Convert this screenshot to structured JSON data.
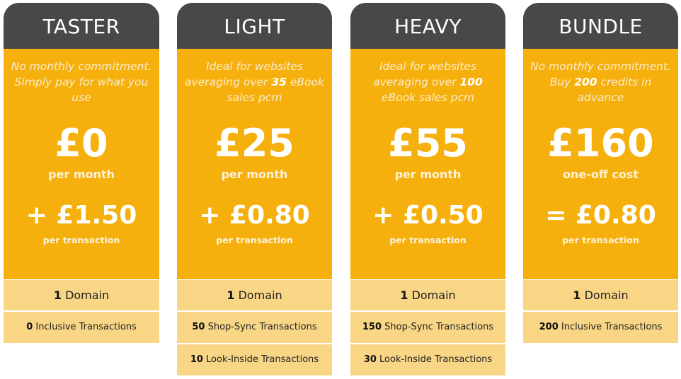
{
  "colors": {
    "header_bg": "#4a4748",
    "main_bg": "#f6b00e",
    "feature_bg": "#f9d686"
  },
  "plans": [
    {
      "name": "TASTER",
      "desc_parts": [
        "No monthly commitment. Simply pay for what you use",
        "",
        ""
      ],
      "price": "£0",
      "period": "per month",
      "rate": "+ £1.50",
      "rate_label": "per transaction",
      "features": [
        {
          "count": "1",
          "label": " Domain"
        },
        {
          "count": "0",
          "label": " Inclusive Transactions"
        }
      ]
    },
    {
      "name": "LIGHT",
      "desc_parts": [
        "Ideal for websites averaging over ",
        "35",
        " eBook sales pcm"
      ],
      "price": "£25",
      "period": "per month",
      "rate": "+ £0.80",
      "rate_label": "per transaction",
      "features": [
        {
          "count": "1",
          "label": " Domain"
        },
        {
          "count": "50",
          "label": " Shop-Sync Transactions"
        },
        {
          "count": "10",
          "label": " Look-Inside Transactions"
        }
      ]
    },
    {
      "name": "HEAVY",
      "desc_parts": [
        "Ideal for websites averaging over ",
        "100",
        " eBook sales pcm"
      ],
      "price": "£55",
      "period": "per month",
      "rate": "+ £0.50",
      "rate_label": "per transaction",
      "features": [
        {
          "count": "1",
          "label": " Domain"
        },
        {
          "count": "150",
          "label": " Shop-Sync Transactions"
        },
        {
          "count": "30",
          "label": " Look-Inside Transactions"
        }
      ]
    },
    {
      "name": "BUNDLE",
      "desc_parts": [
        "No monthly commitment. Buy ",
        "200",
        " credits in advance"
      ],
      "price": "£160",
      "period": "one-off cost",
      "rate": "= £0.80",
      "rate_label": "per transaction",
      "features": [
        {
          "count": "1",
          "label": " Domain"
        },
        {
          "count": "200",
          "label": " Inclusive Transactions"
        }
      ]
    }
  ]
}
